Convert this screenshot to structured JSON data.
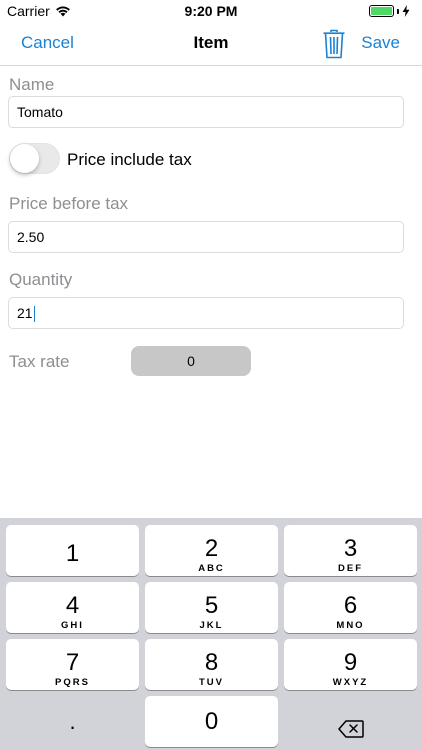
{
  "status_bar": {
    "carrier": "Carrier",
    "time": "9:20 PM",
    "battery_color": "#4cd964"
  },
  "nav": {
    "cancel_label": "Cancel",
    "title": "Item",
    "save_label": "Save",
    "trash_icon": "trash-icon",
    "accent_color": "#1a82d4"
  },
  "form": {
    "name_label": "Name",
    "name_value": "Tomato",
    "tax_toggle_label": "Price include tax",
    "tax_toggle_on": false,
    "price_label": "Price before tax",
    "price_value": "2.50",
    "quantity_label": "Quantity",
    "quantity_value": "21",
    "tax_rate_label": "Tax rate",
    "tax_rate_value": "0"
  },
  "keypad": {
    "keys": [
      {
        "digit": "1",
        "letters": ""
      },
      {
        "digit": "2",
        "letters": "ABC"
      },
      {
        "digit": "3",
        "letters": "DEF"
      },
      {
        "digit": "4",
        "letters": "GHI"
      },
      {
        "digit": "5",
        "letters": "JKL"
      },
      {
        "digit": "6",
        "letters": "MNO"
      },
      {
        "digit": "7",
        "letters": "PQRS"
      },
      {
        "digit": "8",
        "letters": "TUV"
      },
      {
        "digit": "9",
        "letters": "WXYZ"
      }
    ],
    "decimal": ".",
    "zero": "0",
    "backspace_icon": "backspace-icon"
  }
}
